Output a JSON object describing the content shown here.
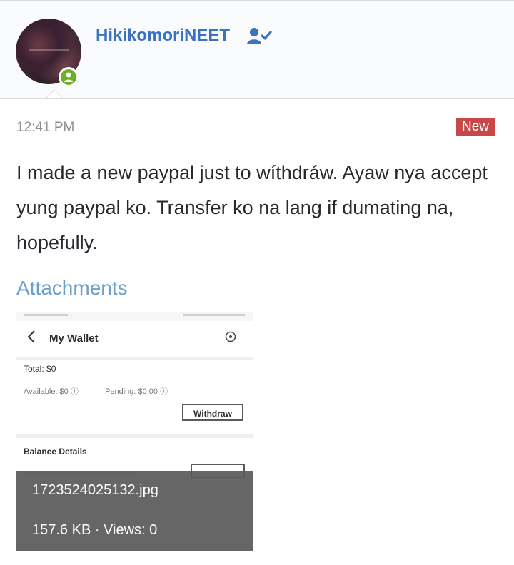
{
  "post": {
    "author": "HikikomoriNEET",
    "time": "12:41 PM",
    "badge": "New",
    "message": "I made a new paypal just to wíthdráw. Ayaw nya accept yung paypal ko. Transfer ko na lang if dumating na, hopefully.",
    "attachments_title": "Attachments"
  },
  "attachment": {
    "filename": "1723524025132.jpg",
    "meta": "157.6 KB · Views: 0",
    "thumbnail": {
      "title": "My Wallet",
      "total": "Total: $0",
      "available": "Available: $0 ⓘ",
      "pending": "Pending: $0.00 ⓘ",
      "withdraw_label": "Withdraw",
      "balance_title": "Balance Details"
    }
  },
  "colors": {
    "username": "#3b73c4",
    "new_badge": "#c8484a",
    "online": "#6bb026",
    "attachments_link": "#6d9fcb"
  },
  "icons": [
    "user-check-icon",
    "online-user-icon",
    "back-chevron-icon",
    "help-icon"
  ]
}
